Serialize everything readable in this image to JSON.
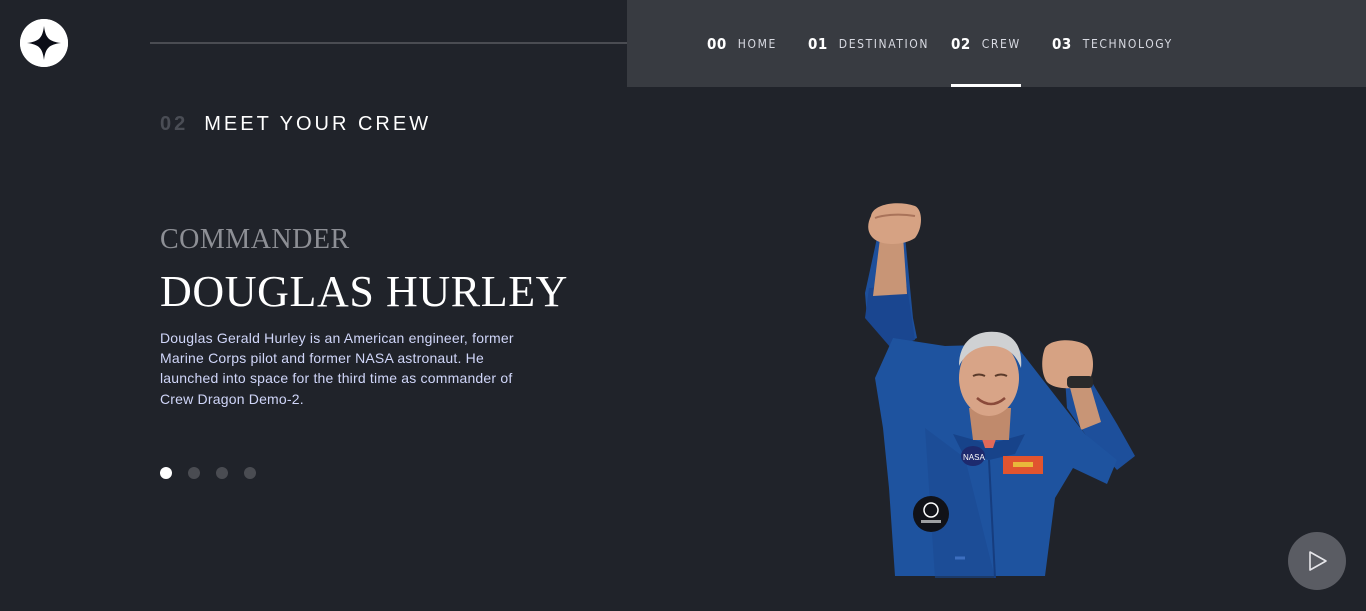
{
  "nav": {
    "items": [
      {
        "num": "00",
        "label": "HOME"
      },
      {
        "num": "01",
        "label": "DESTINATION"
      },
      {
        "num": "02",
        "label": "CREW"
      },
      {
        "num": "03",
        "label": "TECHNOLOGY"
      }
    ],
    "active_index": 2
  },
  "heading": {
    "num": "02",
    "text": "MEET YOUR CREW"
  },
  "crew": {
    "role": "COMMANDER",
    "name": "DOUGLAS HURLEY",
    "bio": "Douglas Gerald Hurley is an American engineer, former Marine Corps pilot and former NASA astronaut. He launched into space for the third time as commander of Crew Dragon Demo-2."
  },
  "pagination": {
    "count": 4,
    "active_index": 0
  },
  "icons": {
    "logo": "star-logo-icon",
    "play": "play-icon"
  },
  "colors": {
    "background": "#20232a",
    "navbar": "#383b41",
    "role_text": "#8d8f95",
    "bio_text": "#d0d6f9"
  }
}
